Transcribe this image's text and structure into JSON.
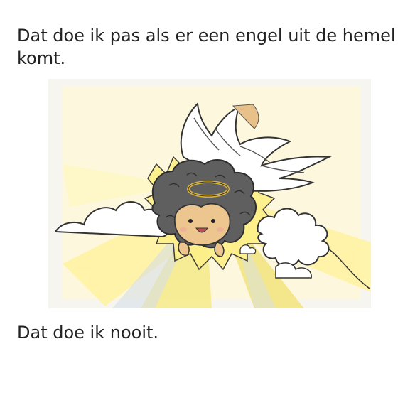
{
  "page": {
    "line1": "Dat doe ik pas als er een engel uit de hemel komt.",
    "line2": "Dat doe ik nooit."
  },
  "illustration": {
    "subject": "angel-icon",
    "colors": {
      "paper": "#f7f5ef",
      "sky": "#fff7b8",
      "rays": "#f4e77a",
      "hair": "#5f5f5f",
      "skin": "#ecc58f",
      "halo": "#e2be4b"
    }
  }
}
